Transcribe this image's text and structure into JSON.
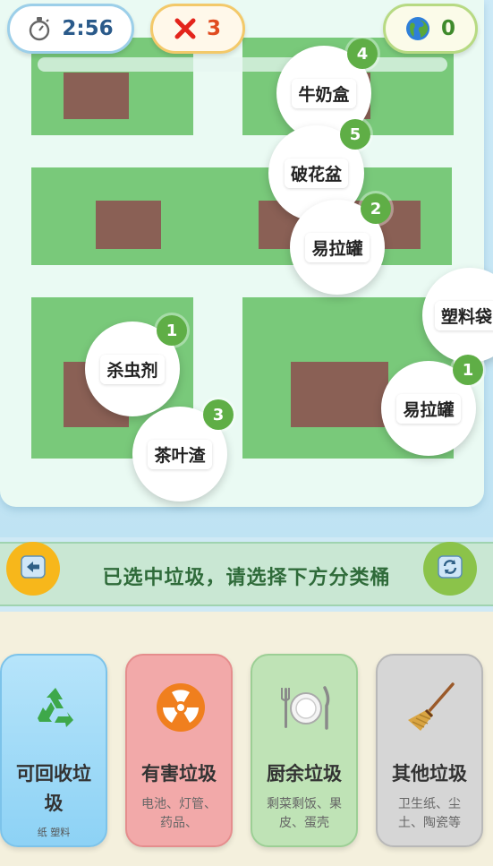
{
  "hud": {
    "timer_icon": "stopwatch-icon",
    "timer": "2:56",
    "mistakes_icon": "red-x-icon",
    "mistakes": "3",
    "score_icon": "globe-icon",
    "score": "0"
  },
  "items": [
    {
      "label": "牛奶盒",
      "badge": "4"
    },
    {
      "label": "破花盆",
      "badge": "5"
    },
    {
      "label": "易拉罐",
      "badge": "2"
    },
    {
      "label": "塑料袋",
      "badge": ""
    },
    {
      "label": "杀虫剂",
      "badge": "1"
    },
    {
      "label": "易拉罐",
      "badge": "1"
    },
    {
      "label": "茶叶渣",
      "badge": "3"
    }
  ],
  "status": {
    "message": "已选中垃圾，请选择下方分类桶",
    "back_icon": "arrow-left-icon",
    "refresh_icon": "refresh-icon"
  },
  "bins": [
    {
      "name": "可回收垃圾",
      "desc": "纸  塑料",
      "icon": "recycle-icon"
    },
    {
      "name": "有害垃圾",
      "desc": "电池、灯管、药品、",
      "icon": "radioactive-icon"
    },
    {
      "name": "厨余垃圾",
      "desc": "剩菜剩饭、果皮、蛋壳",
      "icon": "plate-cutlery-icon"
    },
    {
      "name": "其他垃圾",
      "desc": "卫生纸、尘土、陶瓷等",
      "icon": "broom-icon"
    }
  ],
  "colors": {
    "grass": "#79c97a",
    "roof": "#8a6055",
    "badge": "#5fae46",
    "status_text": "#2f6b3a",
    "back_button": "#f7b71b",
    "refresh_button": "#8bc34a"
  }
}
